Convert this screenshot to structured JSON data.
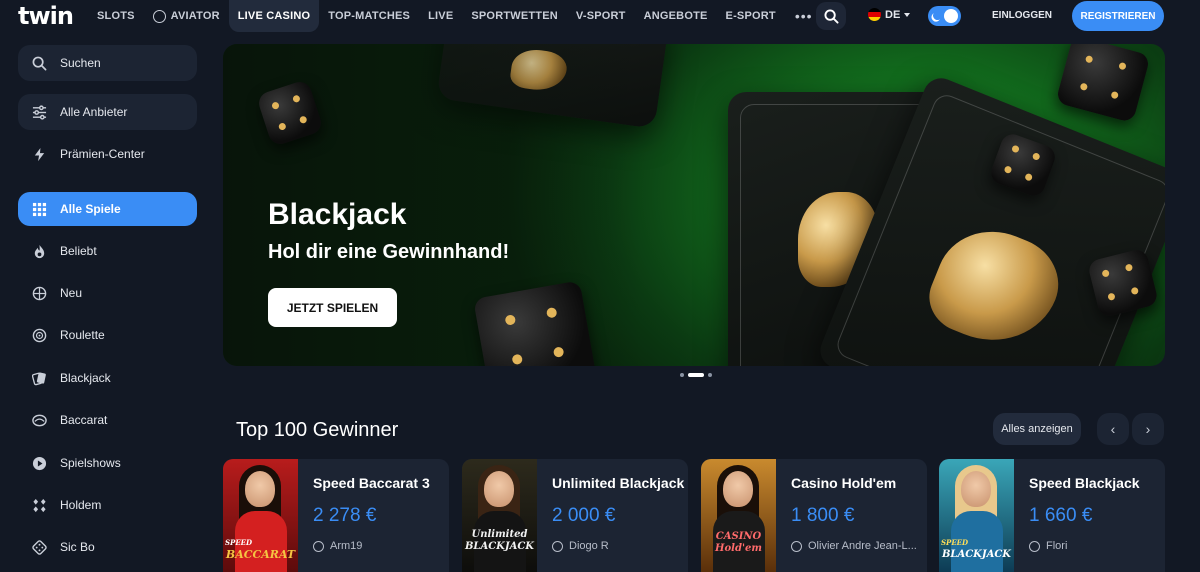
{
  "header": {
    "logo": "twin",
    "nav": [
      {
        "label": "SLOTS"
      },
      {
        "label": "AVIATOR",
        "icon": "globe-icon"
      },
      {
        "label": "LIVE CASINO",
        "active": true
      },
      {
        "label": "TOP-MATCHES"
      },
      {
        "label": "LIVE"
      },
      {
        "label": "SPORTWETTEN"
      },
      {
        "label": "V-SPORT"
      },
      {
        "label": "ANGEBOTE"
      },
      {
        "label": "E-SPORT"
      }
    ],
    "more": "•••",
    "language": "DE",
    "login": "EINLOGGEN",
    "register": "REGISTRIEREN"
  },
  "sidebar": {
    "search": "Suchen",
    "providers": "Alle Anbieter",
    "bonus_center": "Prämien-Center",
    "items": [
      {
        "label": "Alle Spiele",
        "icon": "grid-icon",
        "active": true
      },
      {
        "label": "Beliebt",
        "icon": "flame-icon"
      },
      {
        "label": "Neu",
        "icon": "new-icon"
      },
      {
        "label": "Roulette",
        "icon": "roulette-icon"
      },
      {
        "label": "Blackjack",
        "icon": "cards-icon"
      },
      {
        "label": "Baccarat",
        "icon": "baccarat-icon"
      },
      {
        "label": "Spielshows",
        "icon": "play-icon"
      },
      {
        "label": "Holdem",
        "icon": "holdem-icon"
      },
      {
        "label": "Sic Bo",
        "icon": "dice-icon"
      }
    ]
  },
  "banner": {
    "title": "Blackjack",
    "subtitle": "Hol dir eine Gewinnhand!",
    "cta": "JETZT SPIELEN",
    "slides": 3,
    "active_slide": 2
  },
  "winners": {
    "title": "Top 100 Gewinner",
    "see_all": "Alles anzeigen",
    "prev": "‹",
    "next": "›",
    "cards": [
      {
        "game": "Speed Baccarat 3",
        "amount": "2 278 €",
        "user": "Arm19",
        "thumb_brand": "BACCARAT",
        "thumb_label": "SPEED"
      },
      {
        "game": "Unlimited Blackjack",
        "amount": "2 000 €",
        "user": "Diogo R",
        "thumb_brand": "Unlimited BLACKJACK"
      },
      {
        "game": "Casino Hold'em",
        "amount": "1 800 €",
        "user": "Olivier Andre Jean-L...",
        "thumb_brand": "CASINO Hold'em"
      },
      {
        "game": "Speed Blackjack",
        "amount": "1 660 €",
        "user": "Flori",
        "thumb_brand": "BLACKJACK",
        "thumb_label": "SPEED"
      }
    ]
  },
  "colors": {
    "background": "#121824",
    "accent": "#3a8df5",
    "panel": "#1c2433"
  }
}
